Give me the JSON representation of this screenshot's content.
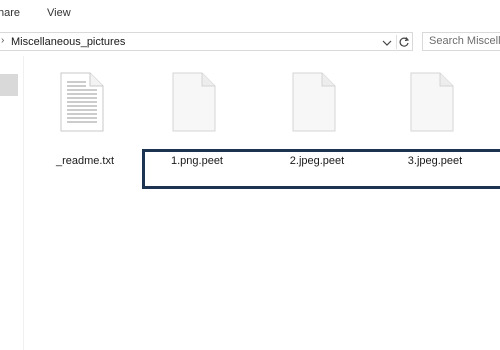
{
  "ribbon": {
    "tabs": [
      {
        "label": "hare"
      },
      {
        "label": "View"
      }
    ]
  },
  "address": {
    "path": "Miscellaneous_pictures",
    "search_placeholder": "Search Miscellaneous_pictures"
  },
  "files": [
    {
      "name": "_readme.txt",
      "icon": "text-file-icon"
    },
    {
      "name": "1.png.peet",
      "icon": "blank-file-icon"
    },
    {
      "name": "2.jpeg.peet",
      "icon": "blank-file-icon"
    },
    {
      "name": "3.jpeg.peet",
      "icon": "blank-file-icon"
    }
  ],
  "colors": {
    "highlight": "#1d3352",
    "nav_selected": "#d9d9d9"
  }
}
